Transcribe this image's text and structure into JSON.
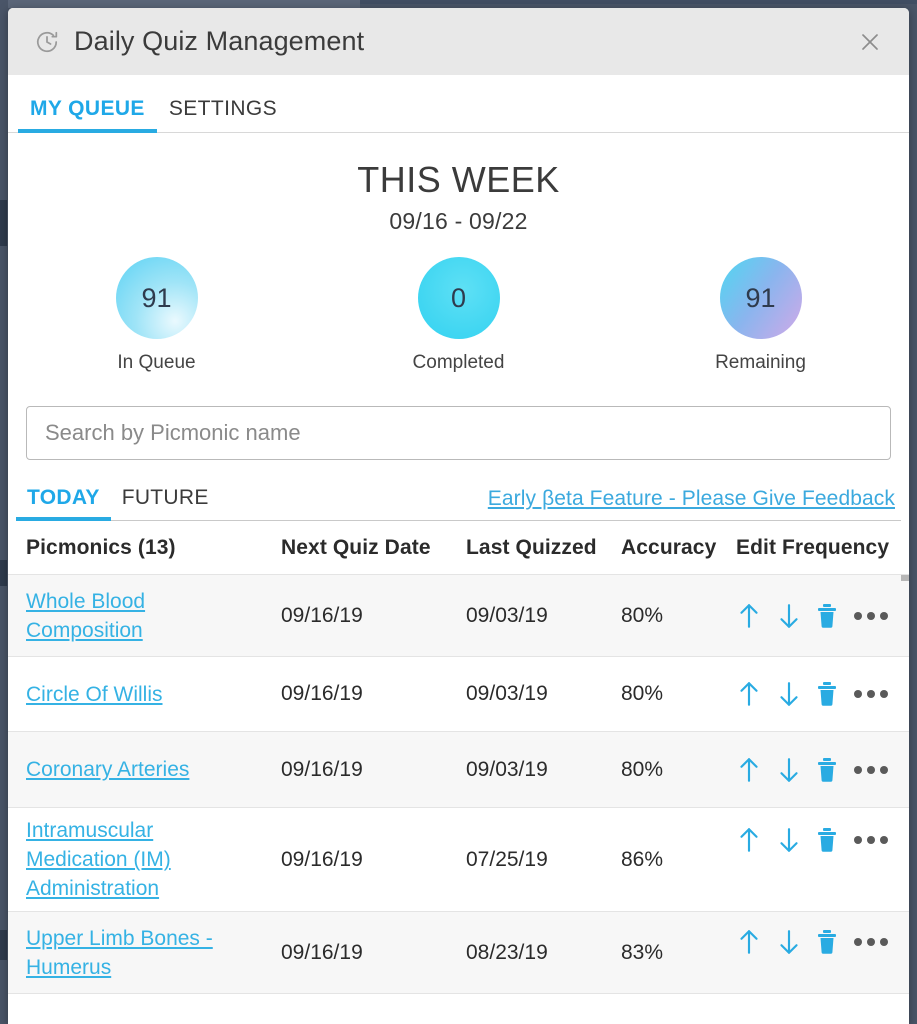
{
  "window": {
    "title": "Daily Quiz Management",
    "title_icon": "clock-refresh-icon",
    "close_icon": "close-icon"
  },
  "top_tabs": [
    {
      "label": "MY QUEUE",
      "active": true
    },
    {
      "label": "SETTINGS",
      "active": false
    }
  ],
  "summary": {
    "heading": "THIS WEEK",
    "date_range": "09/16 - 09/22",
    "stats": [
      {
        "value": "91",
        "label": "In Queue"
      },
      {
        "value": "0",
        "label": "Completed"
      },
      {
        "value": "91",
        "label": "Remaining"
      }
    ]
  },
  "search": {
    "placeholder": "Search by Picmonic name",
    "value": ""
  },
  "sub_tabs": [
    {
      "label": "TODAY",
      "active": true
    },
    {
      "label": "FUTURE",
      "active": false
    }
  ],
  "feedback_link": "Early βeta Feature - Please Give Feedback",
  "table": {
    "headers": {
      "name": "Picmonics (13)",
      "next_quiz_date": "Next Quiz Date",
      "last_quizzed": "Last Quizzed",
      "accuracy": "Accuracy",
      "edit_frequency": "Edit Frequency"
    },
    "rows": [
      {
        "name": "Whole Blood Composition",
        "next_quiz_date": "09/16/19",
        "last_quizzed": "09/03/19",
        "accuracy": "80%"
      },
      {
        "name": "Circle Of Willis",
        "next_quiz_date": "09/16/19",
        "last_quizzed": "09/03/19",
        "accuracy": "80%"
      },
      {
        "name": "Coronary Arteries",
        "next_quiz_date": "09/16/19",
        "last_quizzed": "09/03/19",
        "accuracy": "80%"
      },
      {
        "name": "Intramuscular Medication (IM) Administration",
        "next_quiz_date": "09/16/19",
        "last_quizzed": "07/25/19",
        "accuracy": "86%"
      },
      {
        "name": "Upper Limb Bones - Humerus",
        "next_quiz_date": "09/16/19",
        "last_quizzed": "08/23/19",
        "accuracy": "83%"
      }
    ],
    "row_action_icons": [
      "arrow-up-icon",
      "arrow-down-icon",
      "trash-icon",
      "more-options-icon"
    ]
  },
  "colors": {
    "accent": "#29abe2",
    "link": "#35b2e4",
    "titlebar": "#e8e8e8",
    "backdrop": "#4a5568",
    "bubble_in_queue": "#9fe4f7",
    "bubble_completed": "#43d7f2",
    "bubble_remaining_start": "#4fd7f2",
    "bubble_remaining_end": "#d2a9e8",
    "trash": "#29abe2"
  }
}
